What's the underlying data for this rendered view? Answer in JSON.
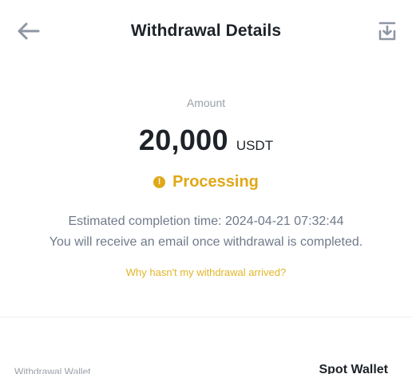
{
  "header": {
    "title": "Withdrawal Details",
    "back_icon": "arrow-left-icon",
    "download_icon": "download-icon"
  },
  "amount": {
    "label": "Amount",
    "value": "20,000",
    "unit": "USDT"
  },
  "status": {
    "icon_glyph": "!",
    "text": "Processing",
    "color": "#e0a818"
  },
  "estimate": {
    "text": "Estimated completion time: 2024-04-21 07:32:44"
  },
  "notice": {
    "text": "You will receive an email once withdrawal is completed."
  },
  "help_link": {
    "text": "Why hasn't my withdrawal arrived?"
  },
  "details": {
    "wallet_label": "Withdrawal Wallet",
    "wallet_value": "Spot Wallet"
  }
}
